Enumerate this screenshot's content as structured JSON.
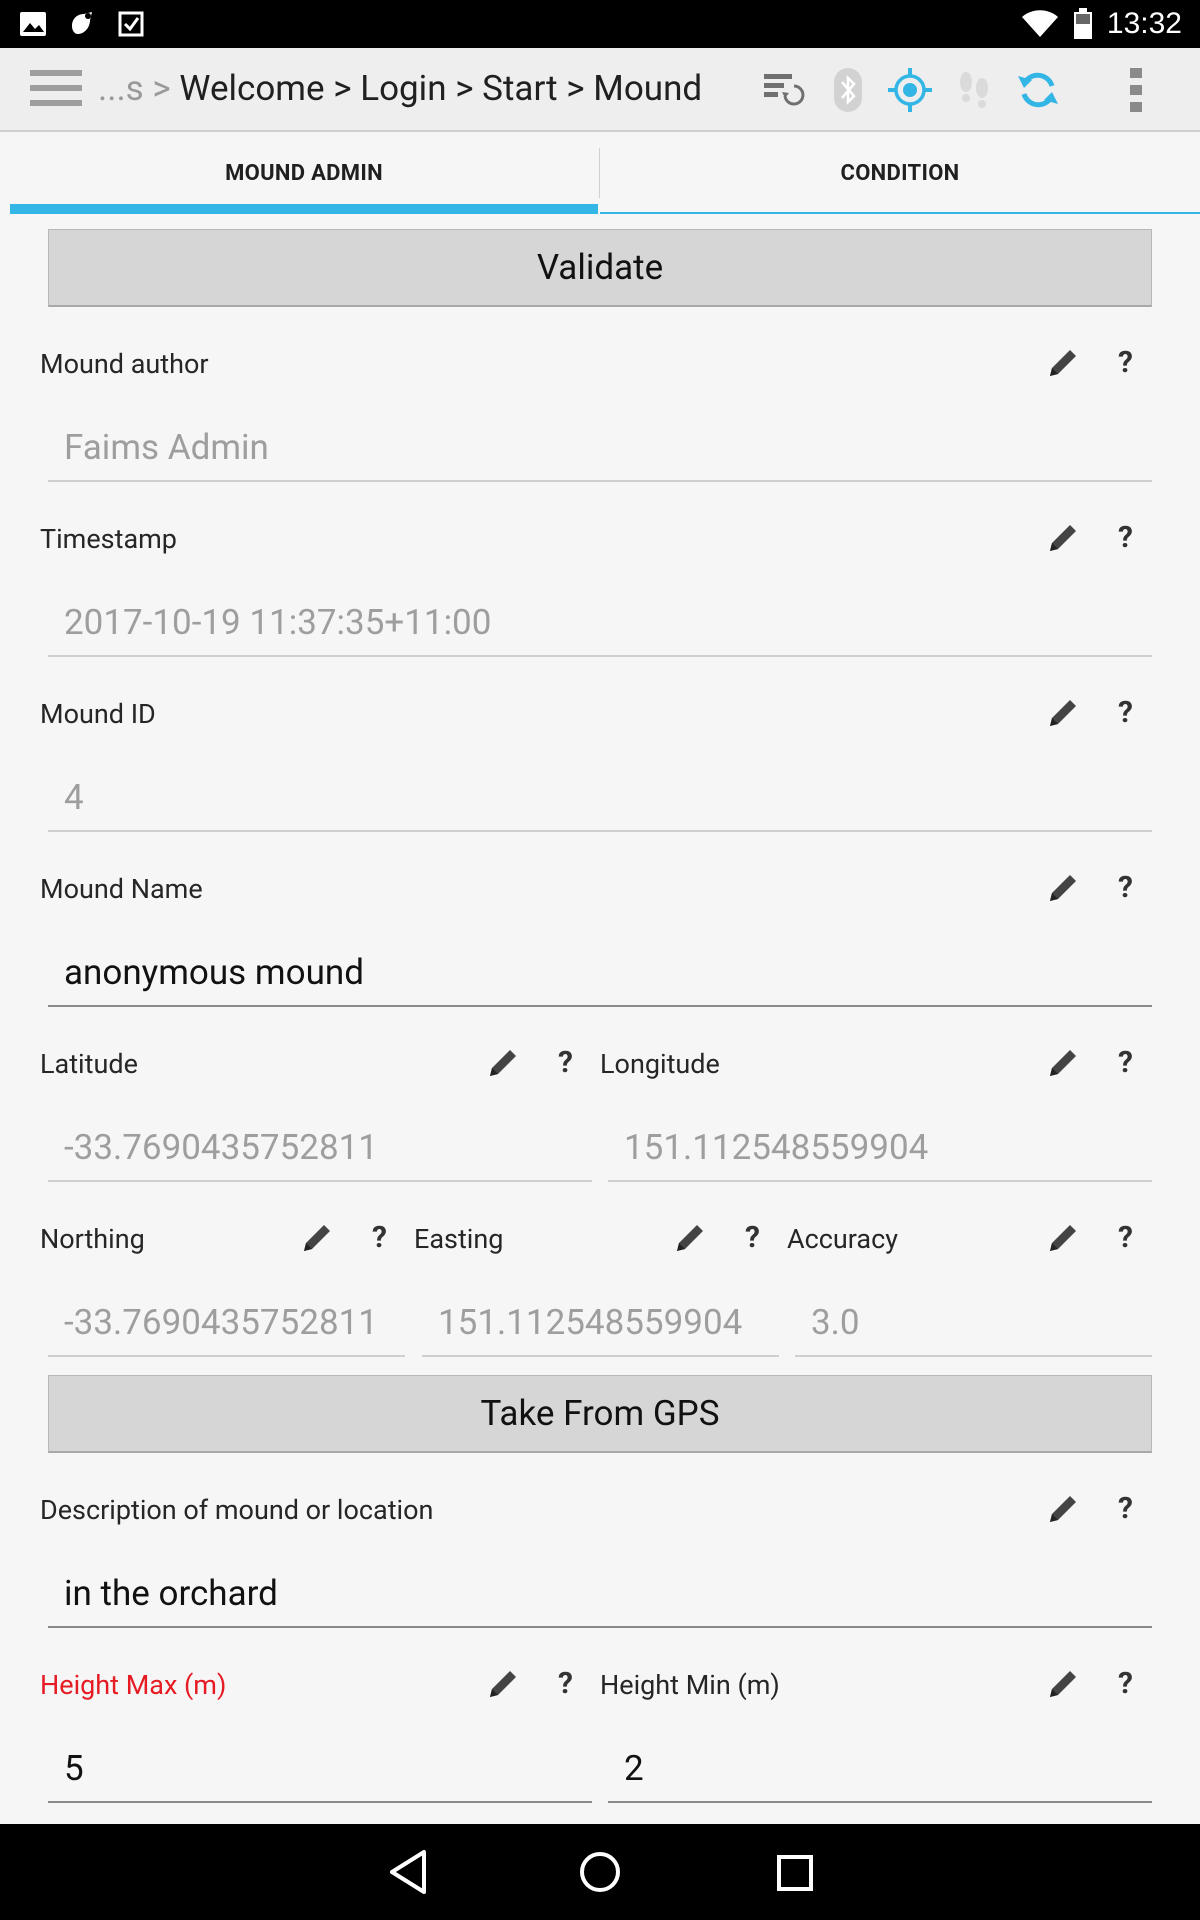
{
  "status_bar": {
    "time": "13:32"
  },
  "action_bar": {
    "breadcrumb_prefix": "...s > ",
    "breadcrumb": "Welcome > Login > Start > Mound"
  },
  "tabs": [
    {
      "label": "MOUND ADMIN",
      "active": true
    },
    {
      "label": "CONDITION",
      "active": false
    }
  ],
  "buttons": {
    "validate": "Validate",
    "take_gps": "Take From GPS"
  },
  "fields": {
    "author": {
      "label": "Mound author",
      "value": "Faims Admin"
    },
    "timestamp": {
      "label": "Timestamp",
      "value": "2017-10-19 11:37:35+11:00"
    },
    "mound_id": {
      "label": "Mound ID",
      "value": "4"
    },
    "mound_name": {
      "label": "Mound Name",
      "value": "anonymous mound"
    },
    "latitude": {
      "label": "Latitude",
      "value": "-33.7690435752811"
    },
    "longitude": {
      "label": "Longitude",
      "value": "151.112548559904"
    },
    "northing": {
      "label": "Northing",
      "value": "-33.7690435752811"
    },
    "easting": {
      "label": "Easting",
      "value": "151.112548559904"
    },
    "accuracy": {
      "label": "Accuracy",
      "value": "3.0"
    },
    "description": {
      "label": "Description of mound or location",
      "value": "in the orchard"
    },
    "height_max": {
      "label": "Height Max (m)",
      "value": "5"
    },
    "height_min": {
      "label": "Height Min (m)",
      "value": "2"
    }
  },
  "help_glyph": "?",
  "colors": {
    "accent": "#33b5e5",
    "error_label": "#e51c23",
    "readonly_text": "#9e9e9e"
  },
  "icons": [
    "menu-icon",
    "sync-settings-icon",
    "bluetooth-icon",
    "gps-icon",
    "tracking-icon",
    "refresh-icon",
    "overflow-icon",
    "pencil-icon",
    "help-icon",
    "back-icon",
    "home-icon",
    "recents-icon"
  ]
}
